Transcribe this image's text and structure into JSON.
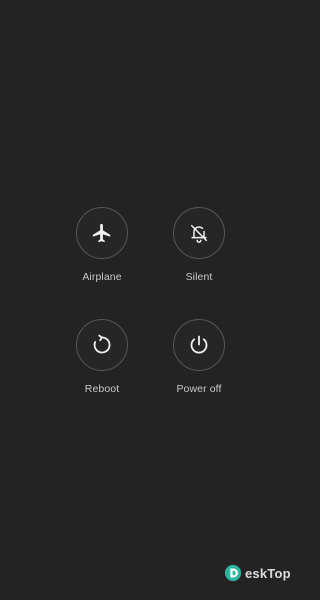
{
  "power_menu": {
    "buttons": [
      {
        "label": "Airplane",
        "icon": "airplane-icon"
      },
      {
        "label": "Silent",
        "icon": "bell-off-icon"
      },
      {
        "label": "Reboot",
        "icon": "reboot-icon"
      },
      {
        "label": "Power off",
        "icon": "power-icon"
      }
    ]
  },
  "watermark": {
    "text": "eskTop",
    "icon": "desktop-logo-icon",
    "color": "#2bb5a0"
  },
  "colors": {
    "background": "#232323",
    "ring": "#565656",
    "icon": "#f2f2f2",
    "label": "#c9c9c9"
  }
}
